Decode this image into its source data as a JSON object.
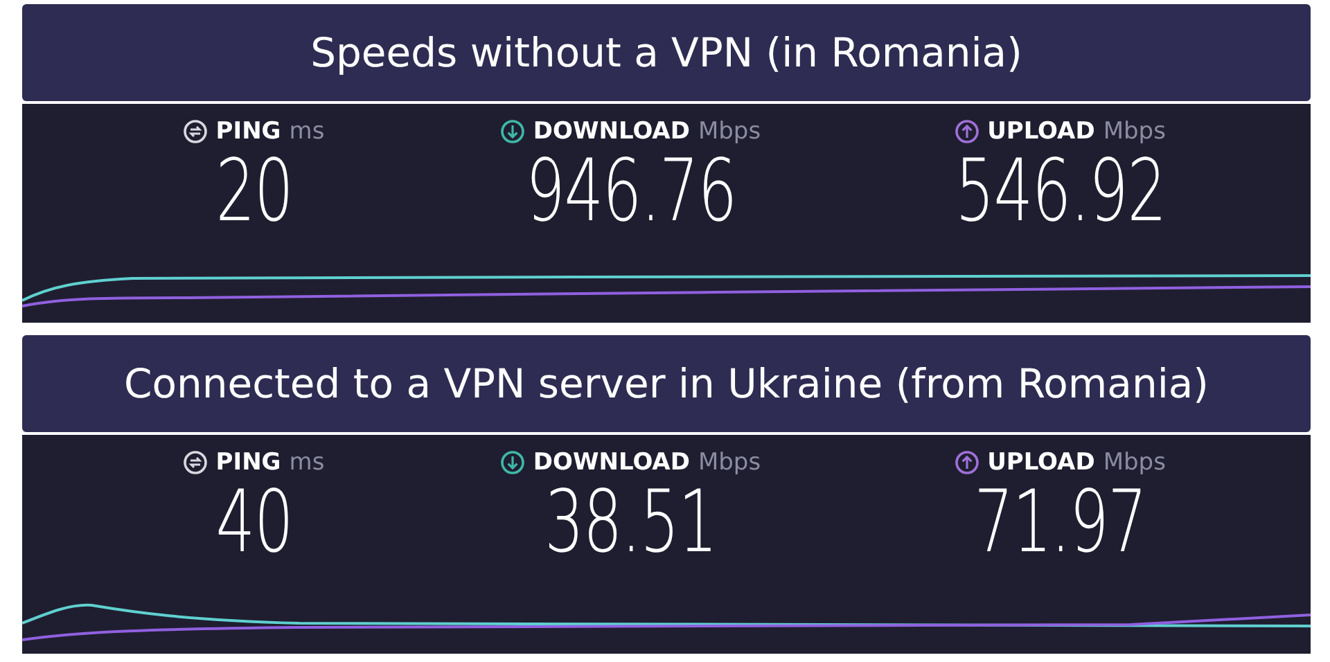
{
  "panels": [
    {
      "caption": "Speeds without a VPN (in Romania)",
      "metrics": [
        {
          "kind": "ping",
          "label": "PING",
          "unit": "ms",
          "value": "20"
        },
        {
          "kind": "download",
          "label": "DOWNLOAD",
          "unit": "Mbps",
          "value": "946.76"
        },
        {
          "kind": "upload",
          "label": "UPLOAD",
          "unit": "Mbps",
          "value": "546.92"
        }
      ]
    },
    {
      "caption": "Connected to a VPN server in Ukraine (from Romania)",
      "metrics": [
        {
          "kind": "ping",
          "label": "PING",
          "unit": "ms",
          "value": "40"
        },
        {
          "kind": "download",
          "label": "DOWNLOAD",
          "unit": "Mbps",
          "value": "38.51"
        },
        {
          "kind": "upload",
          "label": "UPLOAD",
          "unit": "Mbps",
          "value": "71.97"
        }
      ]
    }
  ]
}
